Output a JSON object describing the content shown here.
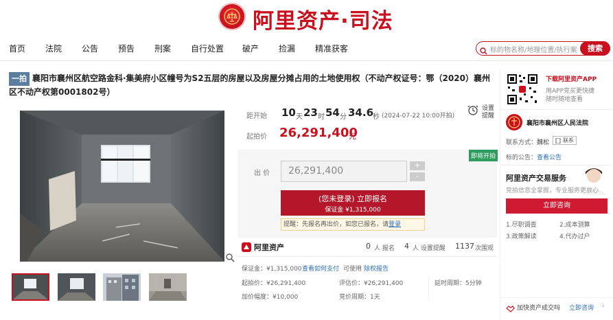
{
  "header": {
    "brand": "阿里资产·司法"
  },
  "nav": {
    "items": [
      "首页",
      "法院",
      "公告",
      "预告",
      "刑案",
      "自行处置",
      "破产",
      "捡漏",
      "精准获客"
    ]
  },
  "search": {
    "placeholder": "标的物名称/地理位置/执行案号",
    "button": "搜索"
  },
  "auction": {
    "badge": "一拍",
    "title": "襄阳市襄州区航空路金科·集美府小区幢号为S2五层的房屋以及房屋分摊占用的土地使用权（不动产权证号：鄂（2020）襄州区不动产权第0001802号）",
    "countdown_label": "距开始",
    "days": "10",
    "days_unit": "天",
    "hours": "23",
    "hours_unit": "时",
    "mins": "54",
    "mins_unit": "分",
    "secs": "34.6",
    "secs_unit": "秒",
    "start_time": "(2024-07-22 10:00开拍)",
    "remind_label_1": "设置",
    "remind_label_2": "提醒",
    "start_price_label": "起拍价",
    "start_price": "26,291,400",
    "price_unit": "元",
    "tag_status": "即将开拍",
    "bid_label": "出 价",
    "bid_value": "26,291,400",
    "plus": "+",
    "minus": "-",
    "signup_line1": "(您未登录) 立即报名",
    "signup_line2": "保证金 ¥1,315,000",
    "tip_prefix": "提醒：先报名再出价，如您已报名，请",
    "tip_link": "登录"
  },
  "stats": {
    "brand": "阿里资产",
    "signups_count": "0",
    "signups_label": "人 报名",
    "remind_count": "4",
    "remind_label": "人 设置提醒",
    "views_count": "1137",
    "views_label": "次围观"
  },
  "details": {
    "deposit": "保证金：¥1,315,000",
    "deposit_link": "查看如何支付",
    "deposit_available": "可使用",
    "deposit_report": "除权报告",
    "start_price": "起拍价：¥26,291,400",
    "eval_price": "评估价：¥26,291,400",
    "delay_period": "延时周期：5分钟",
    "increment": "加价幅度：¥10,000",
    "bid_cycle": "竞价周期：1天"
  },
  "sidebar": {
    "app_title": "下载阿里资产APP",
    "app_desc_1": "用APP竞买更快捷",
    "app_desc_2": "随时随地查看",
    "court": "襄阳市襄州区人民法院",
    "contact_label": "联系方式：",
    "contact_name": "魏松",
    "contact_btn": "联系",
    "notice_label": "标的公告：",
    "notice_link": "查看公告",
    "service_title": "阿里资产交易服务",
    "service_desc": "竞拍信息全掌握，专业服务更放心",
    "consult_btn": "立即咨询",
    "steps": [
      "1.尽职调查",
      "2.成本测算",
      "3.政策解读",
      "4.代办过户"
    ],
    "footer_text": "加快资产成交吗",
    "footer_link": "立即咨询"
  },
  "colors": {
    "brand_red": "#c8101e",
    "button_red": "#b5172a",
    "link_blue": "#2d6fb8",
    "badge_blue": "#5b7e9e",
    "status_green": "#2e9c5e"
  }
}
